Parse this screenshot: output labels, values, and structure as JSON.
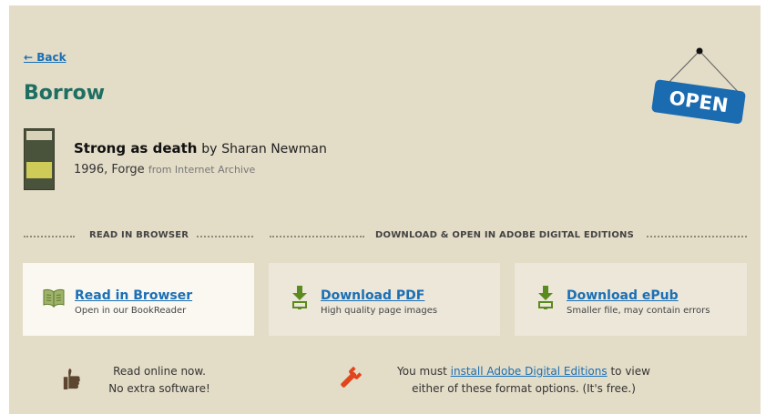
{
  "nav": {
    "back_label": "← Back"
  },
  "page": {
    "title": "Borrow",
    "sign_text": "OPEN"
  },
  "book": {
    "title": "Strong as death",
    "by_label": "by",
    "author": "Sharan Newman",
    "year_publisher": "1996, Forge",
    "source": "from Internet Archive",
    "cover_icon": "book-cover-image"
  },
  "sections": {
    "read_label": "READ IN BROWSER",
    "download_label": "DOWNLOAD & OPEN IN ADOBE DIGITAL EDITIONS"
  },
  "options": [
    {
      "name": "Read in Browser",
      "desc": "Open in our BookReader",
      "icon": "open-book-icon"
    },
    {
      "name": "Download PDF",
      "desc": "High quality page images",
      "icon": "download-icon"
    },
    {
      "name": "Download ePub",
      "desc": "Smaller file, may contain errors",
      "icon": "download-icon"
    }
  ],
  "footer": {
    "read_note_line1": "Read online now.",
    "read_note_line2": "No extra software!",
    "ade_prefix": "You must ",
    "ade_link": "install Adobe Digital Editions",
    "ade_suffix": " to view",
    "ade_line2": "either of these format options. (It's free.)",
    "icons": [
      "thumbs-up-icon",
      "wrench-icon"
    ]
  },
  "colors": {
    "background": "#e3dcc7",
    "title": "#1f6e62",
    "link": "#1a6fb5",
    "sign": "#1a6bb0",
    "download_arrow": "#5b8a1e",
    "wrench": "#e2441c"
  }
}
